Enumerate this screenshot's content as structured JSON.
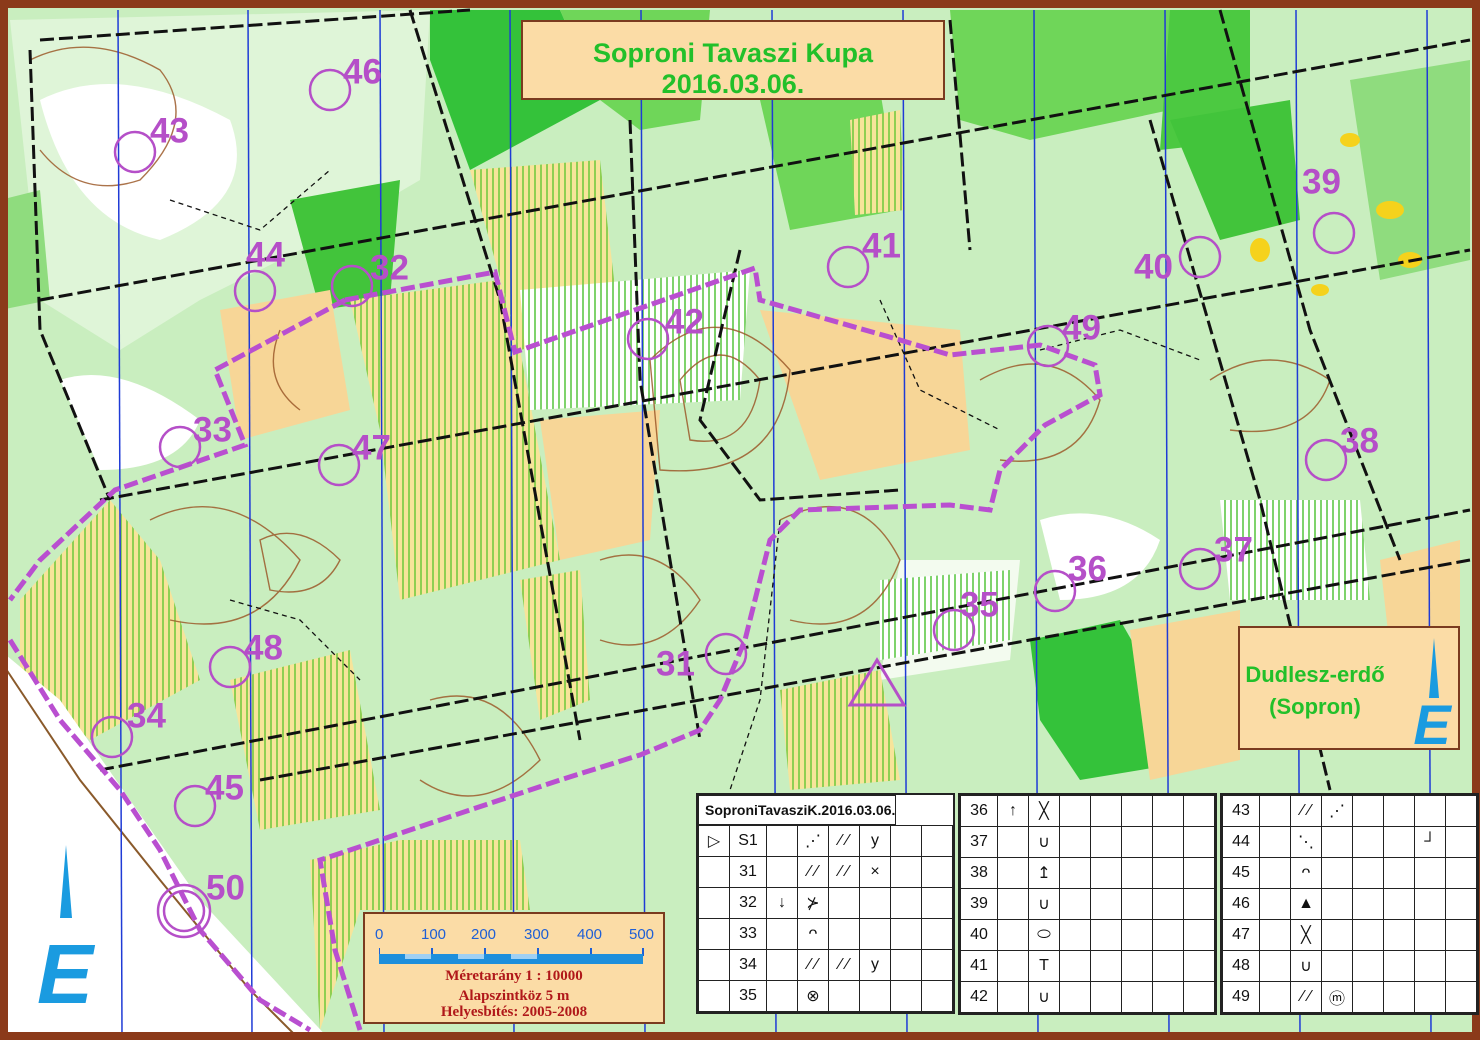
{
  "map": {
    "title_line1": "Soproni Tavaszi Kupa",
    "title_line2": "2016.03.06.",
    "area_line1": "Dudlesz-erdő",
    "area_line2": "(Sopron)",
    "north_glyph": "E"
  },
  "controls": [
    {
      "label": "46"
    },
    {
      "label": "43"
    },
    {
      "label": "44"
    },
    {
      "label": "32"
    },
    {
      "label": "33"
    },
    {
      "label": "47"
    },
    {
      "label": "42"
    },
    {
      "label": "41"
    },
    {
      "label": "40"
    },
    {
      "label": "39"
    },
    {
      "label": "49"
    },
    {
      "label": "38"
    },
    {
      "label": "37"
    },
    {
      "label": "36"
    },
    {
      "label": "35"
    },
    {
      "label": "31"
    },
    {
      "label": "48"
    },
    {
      "label": "34"
    },
    {
      "label": "45"
    },
    {
      "label": "50"
    }
  ],
  "scale": {
    "ticks": [
      "0",
      "100",
      "200",
      "300",
      "400",
      "500"
    ],
    "ratio": "Méretarány  1 : 10000",
    "contour": "Alapszintköz  5 m",
    "revision": "Helyesbítés: 2005-2008"
  },
  "descriptions": {
    "header": "SoproniTavasziK.2016.03.06.",
    "table1": [
      [
        "▷",
        "S1",
        "",
        "⋰",
        "⁄ ⁄",
        "y",
        "",
        ""
      ],
      [
        "",
        "31",
        "",
        "⁄ ⁄",
        "⁄ ⁄",
        "×",
        "",
        ""
      ],
      [
        "",
        "32",
        "↓",
        "⊁",
        "",
        "",
        "",
        ""
      ],
      [
        "",
        "33",
        "",
        "ᴖ",
        "",
        "",
        "",
        ""
      ],
      [
        "",
        "34",
        "",
        "⁄ ⁄",
        "⁄ ⁄",
        "y",
        "",
        ""
      ],
      [
        "",
        "35",
        "",
        "⊗",
        "",
        "",
        "",
        ""
      ]
    ],
    "table2": [
      [
        "36",
        "↑",
        "╳",
        "",
        "",
        "",
        "",
        ""
      ],
      [
        "37",
        "",
        "∪",
        "",
        "",
        "",
        "",
        ""
      ],
      [
        "38",
        "",
        "↥",
        "",
        "",
        "",
        "",
        ""
      ],
      [
        "39",
        "",
        "∪",
        "",
        "",
        "",
        "",
        ""
      ],
      [
        "40",
        "",
        "⬭",
        "",
        "",
        "",
        "",
        ""
      ],
      [
        "41",
        "",
        "T",
        "",
        "",
        "",
        "",
        ""
      ],
      [
        "42",
        "",
        "∪",
        "",
        "",
        "",
        "",
        ""
      ]
    ],
    "table3": [
      [
        "43",
        "",
        "⁄ ⁄",
        "⋰",
        "",
        "",
        "",
        ""
      ],
      [
        "44",
        "",
        "⋱",
        "",
        "",
        "",
        "┘",
        ""
      ],
      [
        "45",
        "",
        "ᴖ",
        "",
        "",
        "",
        "",
        ""
      ],
      [
        "46",
        "",
        "▲",
        "",
        "",
        "",
        "",
        ""
      ],
      [
        "47",
        "",
        "╳",
        "",
        "",
        "",
        "",
        ""
      ],
      [
        "48",
        "",
        "∪",
        "",
        "",
        "",
        "",
        ""
      ],
      [
        "49",
        "",
        "⁄ ⁄",
        "ⓜ",
        "",
        "",
        "",
        ""
      ]
    ]
  }
}
